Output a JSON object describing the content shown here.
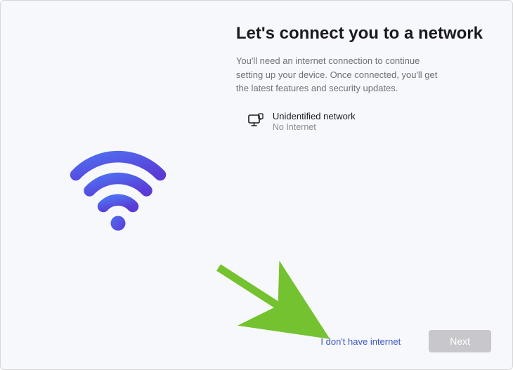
{
  "title": "Let's connect you to a network",
  "subtitle": "You'll need an internet connection to continue setting up your device. Once connected, you'll get the latest features and security updates.",
  "network": {
    "name": "Unidentified network",
    "status": "No Internet"
  },
  "footer": {
    "skip_link": "I don't have internet",
    "next_label": "Next"
  },
  "colors": {
    "accent_start": "#4f6cf0",
    "accent_end": "#5a3bd6",
    "link": "#3a53c5",
    "button_disabled_bg": "#c8c8cc",
    "arrow": "#74c22f"
  }
}
